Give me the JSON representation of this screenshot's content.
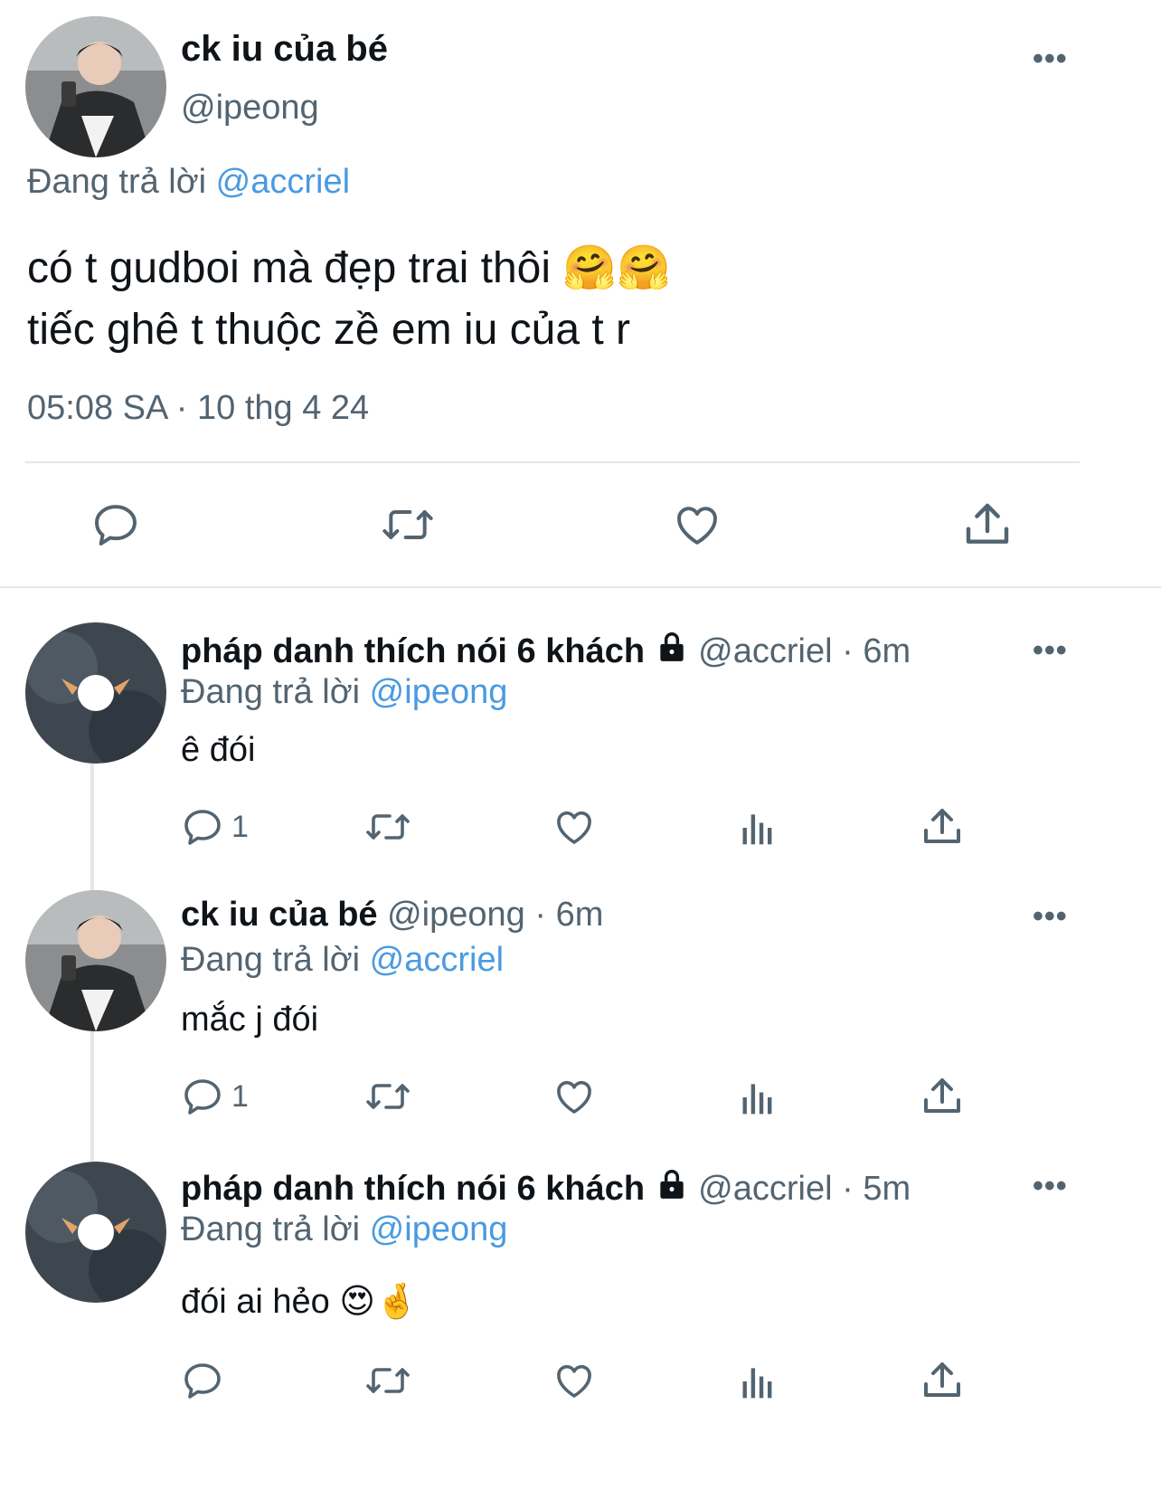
{
  "main_tweet": {
    "display_name": "ck iu của bé",
    "handle": "@ipeong",
    "reply_prefix": "Đang trả lời",
    "reply_to": "@accriel",
    "line1": "có t gudboi mà đẹp trai thôi",
    "line1_emoji": "🤗🤗",
    "line2": "tiếc ghê t thuộc zề em iu của t r",
    "timestamp": "05:08 SA · 10 thg 4 24",
    "actions": [
      "reply-icon",
      "retweet-icon",
      "like-icon",
      "share-icon"
    ]
  },
  "replies": [
    {
      "display_name": "pháp danh thích nói 6 khách",
      "protected": true,
      "handle_time": "@accriel · 6m",
      "reply_prefix": "Đang trả lời",
      "reply_to": "@ipeong",
      "text": "ê đói",
      "emoji": "",
      "reply_count": "1"
    },
    {
      "display_name": "ck iu của bé",
      "protected": false,
      "handle_time": "@ipeong · 6m",
      "reply_prefix": "Đang trả lời",
      "reply_to": "@accriel",
      "text": "mắc j đói",
      "emoji": "",
      "reply_count": "1"
    },
    {
      "display_name": "pháp danh thích nói 6 khách",
      "protected": true,
      "handle_time": "@accriel · 5m",
      "reply_prefix": "Đang trả lời",
      "reply_to": "@ipeong",
      "text": "đói ai hẻo",
      "emoji": "😍🤞",
      "reply_count": ""
    }
  ],
  "more_label": "•••",
  "colors": {
    "link": "#4a9ae0",
    "secondary": "#536471",
    "divider": "#e6e6e6"
  }
}
